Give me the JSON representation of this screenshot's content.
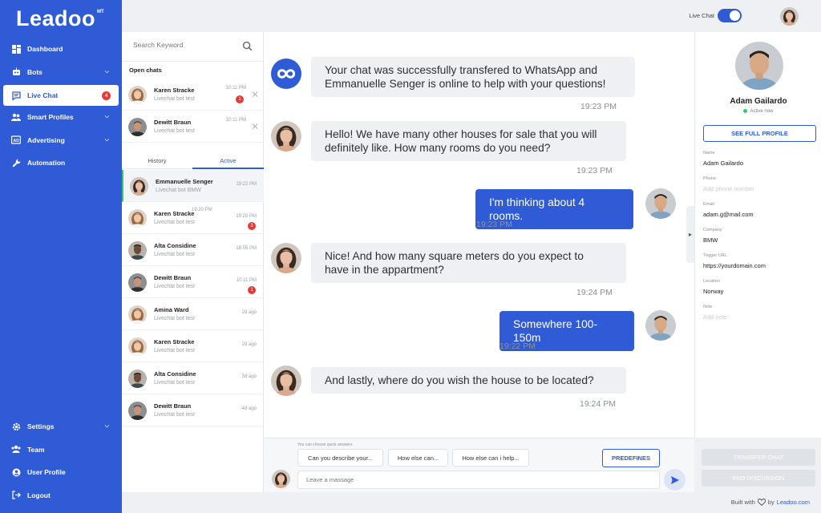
{
  "app": {
    "logo_text": "Leadoo",
    "logo_sup": "MT"
  },
  "sidebar": {
    "items": [
      {
        "label": "Dashboard",
        "icon": "dashboard-icon"
      },
      {
        "label": "Bots",
        "icon": "bot-icon",
        "expandable": true
      },
      {
        "label": "Live Chat",
        "icon": "chat-icon",
        "active": true,
        "badge": "4"
      },
      {
        "label": "Smart Profiles",
        "icon": "users-icon",
        "expandable": true
      },
      {
        "label": "Advertising",
        "icon": "ad-icon",
        "expandable": true
      },
      {
        "label": "Automation",
        "icon": "wrench-icon"
      }
    ],
    "bottom_items": [
      {
        "label": "Settings",
        "icon": "gear-icon",
        "expandable": true
      },
      {
        "label": "Team",
        "icon": "team-icon"
      },
      {
        "label": "User Profile",
        "icon": "user-icon"
      },
      {
        "label": "Logout",
        "icon": "logout-icon"
      }
    ]
  },
  "topbar": {
    "live_chat_label": "Live Chat",
    "live_chat_on": true
  },
  "chatlist": {
    "search_placeholder": "Search Keyword",
    "open_chats_title": "Open chats",
    "open_chats": [
      {
        "name": "Karen Stracke",
        "sub": "Livechat bot test",
        "time": "10:11 PM",
        "count": "1"
      },
      {
        "name": "Dewitt Braun",
        "sub": "Livechat bot test",
        "time": "10:11 PM",
        "count": ""
      }
    ],
    "tabs": [
      "History",
      "Active"
    ],
    "active_tab": "Active",
    "history": [
      {
        "name": "Emmanuelle Senger",
        "sub": "Livechat bot BMW",
        "time": "19:22 PM",
        "count": "",
        "selected": true
      },
      {
        "name": "Karen Stracke",
        "sub": "Livechat bot test",
        "time": "19:20 PM",
        "count": "3",
        "overlap": "19:20 PM"
      },
      {
        "name": "Alta Considine",
        "sub": "Livechat bot test",
        "time": "18:55 PM",
        "count": ""
      },
      {
        "name": "Dewitt Braun",
        "sub": "Livechat bot test",
        "time": "10:11 PM",
        "count": "1"
      },
      {
        "name": "Amina Ward",
        "sub": "Livechat bot test",
        "time": "2d ago",
        "count": ""
      },
      {
        "name": "Karen Stracke",
        "sub": "Livechat bot test",
        "time": "2d ago",
        "count": ""
      },
      {
        "name": "Alta Considine",
        "sub": "Livechat bot test",
        "time": "3d ago",
        "count": ""
      },
      {
        "name": "Dewitt Braun",
        "sub": "Livechat bot test",
        "time": "4d ago",
        "count": ""
      }
    ]
  },
  "messages": [
    {
      "from": "bot",
      "text_line1": "Your chat was successfully transfered to WhatsApp and",
      "text_line2": "Emmanuelle Senger is online to help with your questions!",
      "time": "19:23 PM"
    },
    {
      "from": "visitor",
      "text_line1": "Hello! We have many other houses for sale that you will",
      "text_line2": "definitely like. How many rooms do you need?",
      "time": "19:23 PM"
    },
    {
      "from": "me",
      "text_line1": "I'm thinking about 4 rooms.",
      "text_line2": "",
      "time": "19:23 PM"
    },
    {
      "from": "visitor",
      "text_line1": "Nice! And how many square meters do you expect to",
      "text_line2": "have in the appartment?",
      "time": "19:24 PM"
    },
    {
      "from": "me",
      "text_line1": "Somewhere 100-150m",
      "text_line2": "",
      "time": "19:22 PM"
    },
    {
      "from": "visitor",
      "text_line1": "And lastly, where do you wish the house to be located?",
      "text_line2": "",
      "time": "19:24 PM"
    }
  ],
  "composer": {
    "hint": "You can choose quick answers",
    "quick_answers": [
      "Can you describe your...",
      "How else can...",
      "How else can i help..."
    ],
    "predefines_label": "PREDEFINES",
    "input_placeholder": "Leave a massage"
  },
  "profile": {
    "name": "Adam Gailardo",
    "status": "Active now",
    "see_full_label": "SEE FULL PROFILE",
    "fields": [
      {
        "label": "Name",
        "value": "Adam Gailardo",
        "placeholder": false
      },
      {
        "label": "Phone",
        "value": "Add phone number",
        "placeholder": true
      },
      {
        "label": "Email",
        "value": "adam.g@mail.com",
        "placeholder": false
      },
      {
        "label": "Company",
        "value": "BMW",
        "placeholder": false
      },
      {
        "label": "Trigger URL",
        "value": "https://yourdomain.com",
        "placeholder": false
      },
      {
        "label": "Location",
        "value": "Norway",
        "placeholder": false
      },
      {
        "label": "Note",
        "value": "Add note",
        "placeholder": true
      }
    ],
    "transfer_label": "TRANSFER CHAT",
    "end_label": "END DISCUSSION"
  },
  "footer": {
    "built_with": "Built with",
    "by": "by",
    "brand": "Leadoo.com"
  },
  "colors": {
    "primary": "#2f5bd6",
    "badge": "#e53935",
    "online": "#2ecc71",
    "bubble": "#eef0f3"
  }
}
